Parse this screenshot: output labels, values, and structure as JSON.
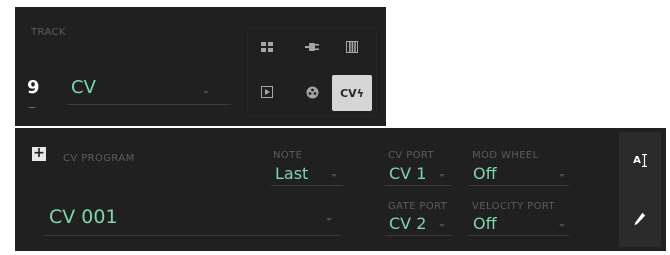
{
  "track": {
    "label": "TRACK",
    "number": "9",
    "number_underscore": "__",
    "name": "CV",
    "type_buttons": [
      {
        "icon": "grid-pads-icon"
      },
      {
        "icon": "plug-icon"
      },
      {
        "icon": "keyboard-icon"
      },
      {
        "icon": "clip-play-icon"
      },
      {
        "icon": "drum-icon"
      },
      {
        "icon": "cv-icon",
        "label": "CVϟ",
        "active": true
      }
    ]
  },
  "cv_program": {
    "add_label": "+",
    "label": "CV PROGRAM",
    "name": "CV 001",
    "note": {
      "label": "NOTE",
      "value": "Last"
    },
    "cv_port": {
      "label": "CV PORT",
      "value": "CV 1"
    },
    "gate_port": {
      "label": "GATE PORT",
      "value": "CV 2"
    },
    "mod_wheel": {
      "label": "MOD WHEEL",
      "value": "Off"
    },
    "velocity_port": {
      "label": "VELOCITY PORT",
      "value": "Off"
    },
    "side_buttons": [
      {
        "icon": "rename-icon",
        "label": "A"
      },
      {
        "icon": "edit-pencil-icon"
      }
    ]
  },
  "colors": {
    "accent": "#7ed6ac",
    "panel": "#202020",
    "label": "#5c5c5c",
    "active_button": "#d5d5d5"
  }
}
